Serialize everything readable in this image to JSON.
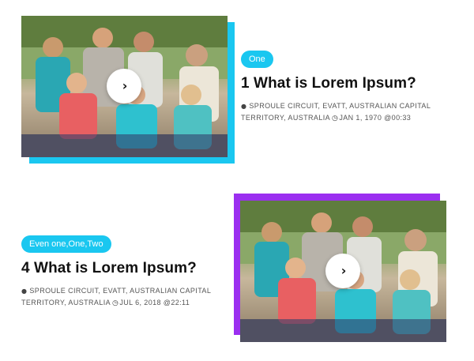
{
  "colors": {
    "cyan_accent": "#1ac7f0",
    "purple_accent": "#9b2ff0",
    "badge_bg": "#1ac7f0"
  },
  "posts": [
    {
      "badge": "One",
      "title": "1 What is Lorem Ipsum?",
      "location_icon": "map-marker-icon",
      "location": "SPROULE CIRCUIT, EVATT, AUSTRALIAN CAPITAL TERRITORY, AUSTRALIA",
      "clock_icon": "clock-icon",
      "date": "JAN 1, 1970 @00:33",
      "play_icon": "chevron-right-icon"
    },
    {
      "badge": "Even one,One,Two",
      "title": "4 What is Lorem Ipsum?",
      "location_icon": "map-marker-icon",
      "location": "SPROULE CIRCUIT, EVATT, AUSTRALIAN CAPITAL TERRITORY, AUSTRALIA",
      "clock_icon": "clock-icon",
      "date": "JUL 6, 2018 @22:11",
      "play_icon": "chevron-right-icon"
    }
  ]
}
